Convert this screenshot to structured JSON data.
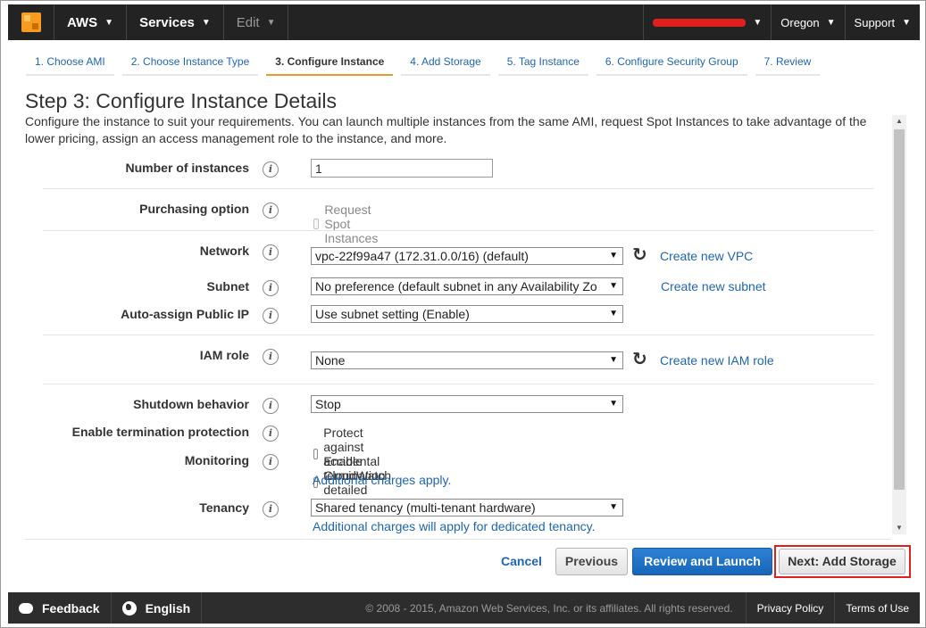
{
  "topbar": {
    "brand": "AWS",
    "services": "Services",
    "edit": "Edit",
    "region": "Oregon",
    "support": "Support"
  },
  "tabs": [
    {
      "label": "1. Choose AMI"
    },
    {
      "label": "2. Choose Instance Type"
    },
    {
      "label": "3. Configure Instance"
    },
    {
      "label": "4. Add Storage"
    },
    {
      "label": "5. Tag Instance"
    },
    {
      "label": "6. Configure Security Group"
    },
    {
      "label": "7. Review"
    }
  ],
  "page": {
    "title": "Step 3: Configure Instance Details",
    "description": "Configure the instance to suit your requirements. You can launch multiple instances from the same AMI, request Spot Instances to take advantage of the lower pricing, assign an access management role to the instance, and more."
  },
  "form": {
    "instances": {
      "label": "Number of instances",
      "value": "1"
    },
    "purchasing": {
      "label": "Purchasing option",
      "checkbox": "Request Spot Instances"
    },
    "network": {
      "label": "Network",
      "value": "vpc-22f99a47 (172.31.0.0/16) (default)",
      "link": "Create new VPC"
    },
    "subnet": {
      "label": "Subnet",
      "value": "No preference (default subnet in any Availability Zo",
      "link": "Create new subnet"
    },
    "public_ip": {
      "label": "Auto-assign Public IP",
      "value": "Use subnet setting (Enable)"
    },
    "iam": {
      "label": "IAM role",
      "value": "None",
      "link": "Create new IAM role"
    },
    "shutdown": {
      "label": "Shutdown behavior",
      "value": "Stop"
    },
    "termination": {
      "label": "Enable termination protection",
      "checkbox": "Protect against accidental termination"
    },
    "monitoring": {
      "label": "Monitoring",
      "checkbox": "Enable CloudWatch detailed monitoring",
      "note": "Additional charges apply."
    },
    "tenancy": {
      "label": "Tenancy",
      "value": "Shared tenancy (multi-tenant hardware)",
      "note": "Additional charges will apply for dedicated tenancy."
    }
  },
  "actions": {
    "cancel": "Cancel",
    "previous": "Previous",
    "review": "Review and Launch",
    "next": "Next: Add Storage"
  },
  "footer": {
    "feedback": "Feedback",
    "language": "English",
    "copyright": "© 2008 - 2015, Amazon Web Services, Inc. or its affiliates. All rights reserved.",
    "privacy": "Privacy Policy",
    "terms": "Terms of Use"
  },
  "colors": {
    "accent": "#e99a2c",
    "link": "#1f66b1",
    "primary_button": "#1765b7",
    "highlight": "#e0201f"
  }
}
